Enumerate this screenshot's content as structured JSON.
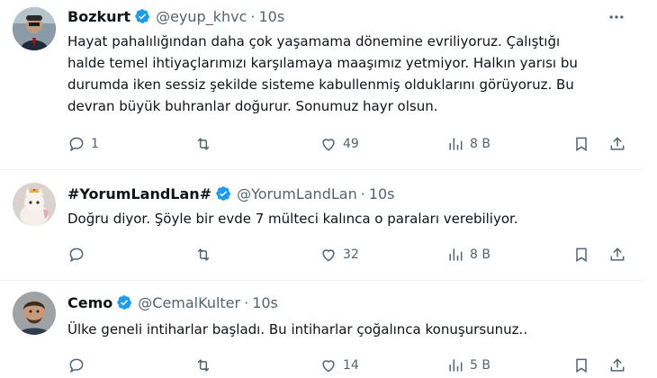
{
  "tweets": [
    {
      "name": "Bozkurt",
      "handle": "@eyup_khvc",
      "dot": "·",
      "time": "10s",
      "lines": [
        "Hayat pahalılığından daha çok yaşamama dönemine evriliyoruz. Çalıştığı",
        "halde temel ihtiyaçlarımızı karşılamaya maaşımız yetmiyor. Halkın yarısı bu",
        "durumda iken sessiz şekilde sisteme kabullenmiş olduklarını görüyoruz. Bu",
        "devran büyük buhranlar doğurur. Sonumuz hayr olsun."
      ],
      "reply_count": "1",
      "retweet_count": "",
      "like_count": "49",
      "view_count": "8 B"
    },
    {
      "name": "#YorumLandLan#",
      "handle": "@YorumLandLan",
      "dot": "·",
      "time": "10s",
      "lines": [
        "Doğru diyor. Şöyle bir evde 7 mülteci kalınca o paraları verebiliyor."
      ],
      "reply_count": "",
      "retweet_count": "",
      "like_count": "32",
      "view_count": "8 B"
    },
    {
      "name": "Cemo",
      "handle": "@CemalKulter",
      "dot": "·",
      "time": "10s",
      "lines": [
        "Ülke geneli intiharlar başladı. Bu intiharlar çoğalınca konuşursunuz.."
      ],
      "reply_count": "",
      "retweet_count": "",
      "like_count": "14",
      "view_count": "5 B"
    }
  ],
  "colors": {
    "text": "#0f1419",
    "secondary": "#536471",
    "verified": "#1d9bf0",
    "divider": "#eff3f4"
  },
  "icons": [
    "reply-icon",
    "retweet-icon",
    "like-icon",
    "views-icon",
    "bookmark-icon",
    "share-icon",
    "more-icon",
    "verified-badge-icon"
  ]
}
